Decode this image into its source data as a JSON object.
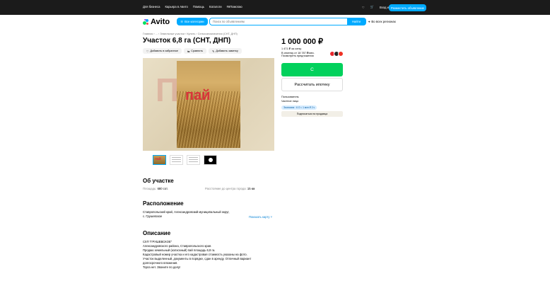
{
  "topbar": {
    "links": [
      "Для бизнеса",
      "Карьера в Авито",
      "Помощь",
      "Каталоги",
      "#яПомогаю"
    ],
    "login": "Вход и регистрация",
    "place_ad": "Разместить объявление"
  },
  "header": {
    "logo": "Avito",
    "all_categories": "Все категории",
    "search_placeholder": "Поиск по объявлениям",
    "find": "Найти",
    "region": "Во всех регионах"
  },
  "breadcrumb": "Главная › ... › Земельные участки › Купить › Сельхозназначения (СНТ, ДНП)",
  "title": "Участок 6,8 га (СНТ, ДНП)",
  "actions": {
    "favorite": "Добавить в избранное",
    "compare": "Сравнить",
    "note": "Добавить заметку"
  },
  "gallery": {
    "watermark": "Пай",
    "photo_text": "пай"
  },
  "price": {
    "value": "1 000 000 ₽",
    "per_unit": "1 471 ₽ за сотку",
    "mortgage": "В ипотеку от 18 787 ₽/мес.",
    "offers_link": "Посмотреть предложения"
  },
  "buttons": {
    "show_phone": "С",
    "mortgage_calc": "Рассчитать ипотеку"
  },
  "seller": {
    "role": "Пользователь",
    "type": "Частное лицо",
    "badge": "Экономия · 6 О ≈ 1 млн ₽ 2 ч",
    "subscribe": "Подписаться на продавца"
  },
  "about": {
    "heading": "Об участке",
    "area_label": "Площадь:",
    "area_value": "680 сот.",
    "distance_label": "Расстояние до центра города:",
    "distance_value": "15 км"
  },
  "location": {
    "heading": "Расположение",
    "address_line1": "Ставропольский край, Александровский муниципальный округ,",
    "address_line2": "с. Грушевское",
    "show_map": "Показать карту"
  },
  "description": {
    "heading": "Описание",
    "lines": [
      "СХП \"ГРУШЕВСКОЕ\"",
      "Александровского района, Ставропольского края.",
      "Продаю земельный (колхозный) пай площадь 6,8 га.",
      "Кадастровый номер участка и его кадастровая стоимость указаны на фото.",
      "Участок выделенный, документы в порядке, сдан в аренду. Отличный вариант",
      "долгосрочного вложения.",
      "Торга нет. Звоните по делу!"
    ]
  },
  "colors": {
    "accent_blue": "#00aaff",
    "green": "#02d15c",
    "topbar": "#1b1b1b"
  }
}
